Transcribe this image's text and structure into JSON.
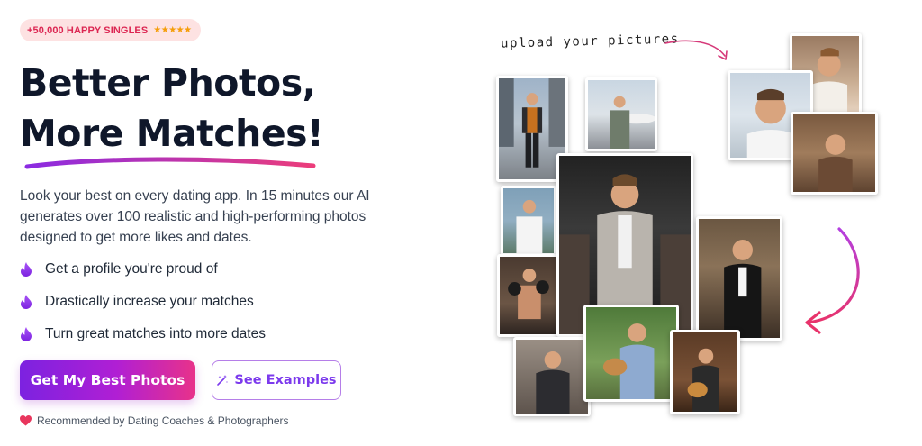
{
  "badge": {
    "text": "+50,000 HAPPY SINGLES",
    "stars": "★★★★★"
  },
  "hero": {
    "line1": "Better Photos,",
    "line2": "More Matches!",
    "description": "Look your best on every dating app. In 15 minutes our AI generates over 100 realistic and high-performing photos designed to get more likes and dates."
  },
  "features": [
    {
      "icon": "flame-icon",
      "text": "Get a profile you're proud of"
    },
    {
      "icon": "flame-icon",
      "text": "Drastically increase your matches"
    },
    {
      "icon": "flame-icon",
      "text": "Turn great matches into more dates"
    }
  ],
  "cta": {
    "primary_label": "Get My Best Photos",
    "secondary_label": "See Examples",
    "secondary_icon": "magic-wand-icon"
  },
  "recommendation": {
    "icon": "heart-icon",
    "text": "Recommended by Dating Coaches & Photographers"
  },
  "upload_note": "upload your pictures",
  "colors": {
    "accent_purple": "#7c22e0",
    "accent_pink": "#e8328a",
    "badge_bg": "#fde2e2",
    "badge_text": "#dc2652",
    "heading": "#0f172a"
  }
}
